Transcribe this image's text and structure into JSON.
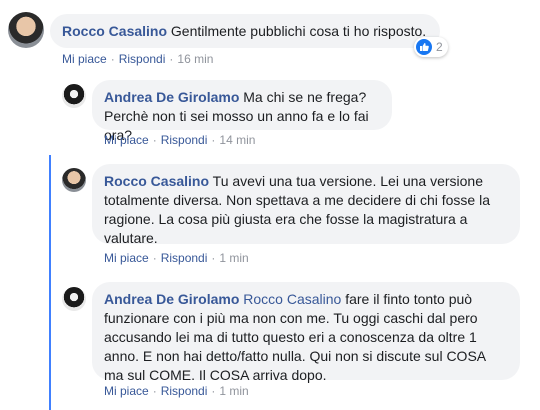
{
  "comments": [
    {
      "author": "Rocco Casalino",
      "text": "Gentilmente pubblichi cosa ti ho risposto.",
      "like": "Mi piace",
      "reply": "Rispondi",
      "time": "16 min",
      "reactions": "2"
    },
    {
      "author": "Andrea De Girolamo",
      "text": "Ma chi se ne frega? Perchè non ti sei mosso un anno fa e lo fai ora?",
      "like": "Mi piace",
      "reply": "Rispondi",
      "time": "14 min"
    },
    {
      "author": "Rocco Casalino",
      "text": "Tu avevi una tua versione. Lei una versione totalmente diversa. Non spettava a me decidere di chi fosse la ragione. La cosa più giusta era che fosse la magistratura a valutare.",
      "like": "Mi piace",
      "reply": "Rispondi",
      "time": "1 min"
    },
    {
      "author": "Andrea De Girolamo",
      "mention": "Rocco Casalino",
      "text": "fare il finto tonto può funzionare con i più ma non con me. Tu oggi caschi dal pero accusando lei ma di tutto questo eri a conoscenza da oltre 1 anno. E non hai detto/fatto nulla. Qui non si discute sul COSA ma sul COME. Il COSA arriva dopo.",
      "like": "Mi piace",
      "reply": "Rispondi",
      "time": "1 min"
    }
  ]
}
